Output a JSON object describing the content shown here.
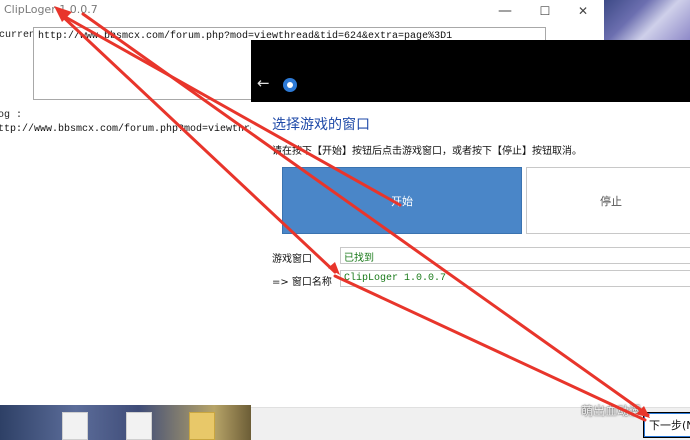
{
  "background_window": {
    "title": "ClipLoger 1.0.0.7",
    "minimize_symbol": "—",
    "maximize_symbol": "☐",
    "close_symbol": "✕",
    "current_label": "current",
    "current_url": "http://www.bbsmcx.com/forum.php?mod=viewthread&tid=624&extra=page%3D1",
    "log_label": "og :",
    "log_text": "ttp://www.bbsmcx.com/forum.php?mod=viewthread&tid"
  },
  "dialog": {
    "back_icon": "back-arrow-icon",
    "heading": "选择游戏的窗口",
    "instruction": "请在按下【开始】按钮后点击游戏窗口，或者按下【停止】按钮取消。",
    "start_label": "开始",
    "stop_label": "停止",
    "game_window_label": "游戏窗口",
    "game_window_value": "已找到",
    "window_name_label": "=> 窗口名称",
    "window_name_value": "ClipLoger 1.0.0.7",
    "next_label": "下一步(N)"
  },
  "watermark": "萌出血动漫",
  "colors": {
    "start_button": "#4a86c8",
    "heading": "#1f4aa8",
    "found_text": "#1a7a1a",
    "annotation_arrow": "#e8352b",
    "dialog_header": "#000000"
  }
}
